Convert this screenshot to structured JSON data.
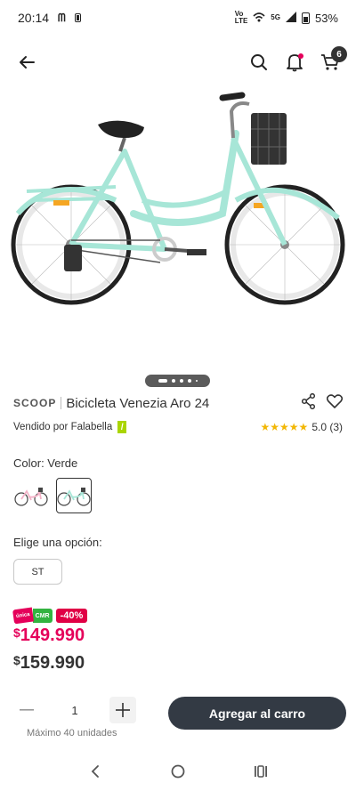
{
  "status_bar": {
    "time": "20:14",
    "volte_top": "Vo",
    "volte_bottom": "LTE",
    "network": "5G",
    "battery": "53%"
  },
  "nav": {
    "cart_count": "6"
  },
  "product": {
    "brand": "SCOOP",
    "title": "Bicicleta Venezia Aro 24",
    "seller": "Vendido por Falabella",
    "seller_badge": "/",
    "stars": "★★★★★",
    "rating": "5.0 (3)",
    "color_label": "Color: Verde",
    "option_label": "Elige una opción:",
    "size_option": "ST",
    "frame_color": "#a7e6d7"
  },
  "pricing": {
    "cmr_unica": "única",
    "cmr_label": "CMR",
    "discount": "-40%",
    "currency": "$",
    "cmr_price": "149.990",
    "normal_price": "159.990",
    "cmr_color": "#e5005a"
  },
  "purchase": {
    "quantity": "1",
    "max_note": "Máximo 40 unidades",
    "add_to_cart": "Agregar al carro",
    "button_color": "#333a44"
  }
}
